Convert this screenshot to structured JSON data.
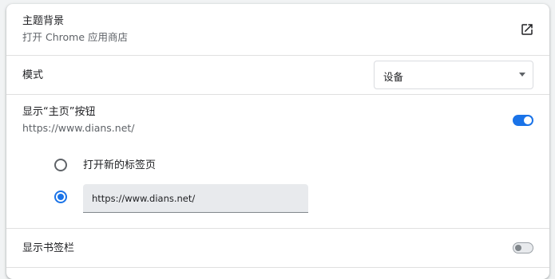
{
  "theme": {
    "title": "主题背景",
    "subtitle": "打开 Chrome 应用商店",
    "action_icon": "open-in-new-icon"
  },
  "mode": {
    "label": "模式",
    "selected": "设备"
  },
  "home_button": {
    "title": "显示“主页”按钮",
    "subtitle": "https://www.dians.net/",
    "enabled": true,
    "options": [
      {
        "label": "打开新的标签页",
        "checked": false
      },
      {
        "value": "https://www.dians.net/",
        "checked": true
      }
    ]
  },
  "bookmarks_bar": {
    "label": "显示书签栏",
    "enabled": false
  },
  "colors": {
    "accent": "#1a73e8",
    "card_bg": "#ffffff",
    "page_bg": "#f1f3f4"
  }
}
